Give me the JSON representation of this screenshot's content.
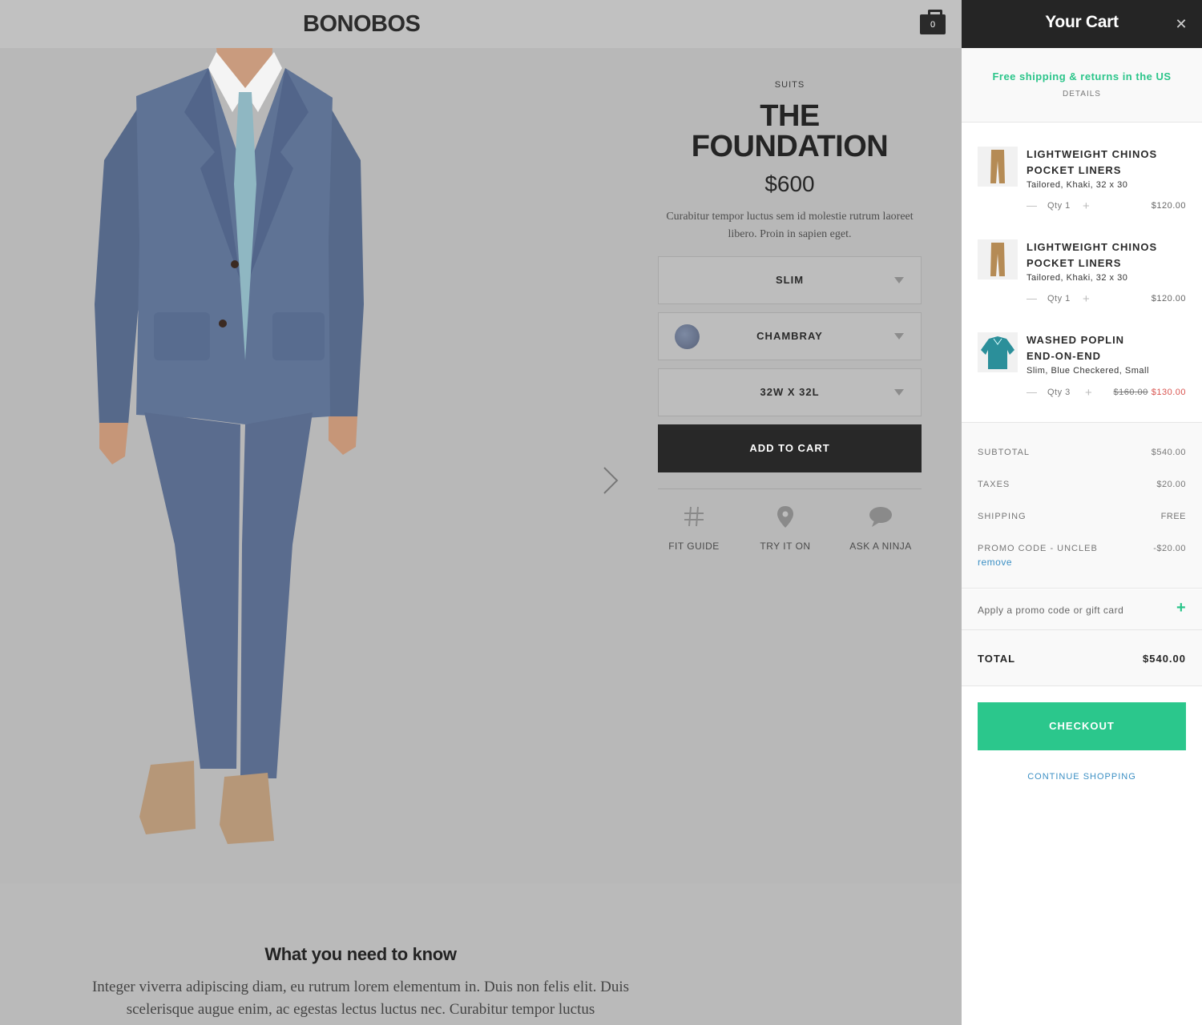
{
  "header": {
    "logo": "BONOBOS",
    "bag_count": "0"
  },
  "product": {
    "category": "SUITS",
    "title_line1": "THE",
    "title_line2": "FOUNDATION",
    "price": "$600",
    "description": "Curabitur tempor luctus sem id molestie rutrum laoreet libero. Proin in sapien eget.",
    "fit_select": "SLIM",
    "color_select": "CHAMBRAY",
    "size_select": "32W X 32L",
    "add_to_cart": "ADD TO CART",
    "tools": [
      {
        "label": "FIT GUIDE",
        "icon": "hash-icon"
      },
      {
        "label": "TRY IT ON",
        "icon": "location-pin-icon"
      },
      {
        "label": "ASK A NINJA",
        "icon": "chat-bubble-icon"
      }
    ]
  },
  "info": {
    "heading": "What you need to know",
    "body": "Integer viverra adipiscing diam, eu rutrum lorem elementum in. Duis non felis elit. Duis scelerisque augue enim, ac egestas lectus luctus nec. Curabitur tempor luctus"
  },
  "cart": {
    "title": "Your Cart",
    "close_icon": "close-icon",
    "shipping_note": "Free shipping & returns in the US",
    "details": "DETAILS",
    "items": [
      {
        "name_line1": "LIGHTWEIGHT CHINOS",
        "name_line2": "POCKET LINERS",
        "desc": "Tailored, Khaki, 32 x 30",
        "qty": "Qty 1",
        "price": "$120.00",
        "thumb": "khaki-chinos"
      },
      {
        "name_line1": "LIGHTWEIGHT CHINOS",
        "name_line2": "POCKET LINERS",
        "desc": "Tailored, Khaki, 32 x 30",
        "qty": "Qty 1",
        "price": "$120.00",
        "thumb": "khaki-chinos"
      },
      {
        "name_line1": "WASHED POPLIN",
        "name_line2": "END-ON-END",
        "desc": "Slim, Blue Checkered, Small",
        "qty": "Qty 3",
        "original_price": "$160.00",
        "price": "$130.00",
        "thumb": "blue-checkered-shirt"
      }
    ],
    "summary": {
      "subtotal_label": "SUBTOTAL",
      "subtotal": "$540.00",
      "taxes_label": "TAXES",
      "taxes": "$20.00",
      "shipping_label": "SHIPPING",
      "shipping": "FREE",
      "promo_label": "PROMO CODE - UNCLEB",
      "promo": "-$20.00",
      "remove": "remove"
    },
    "promo_prompt": "Apply a promo code or gift card",
    "total_label": "TOTAL",
    "total": "$540.00",
    "checkout": "CHECKOUT",
    "continue": "CONTINUE SHOPPING"
  },
  "colors": {
    "accent_green": "#2bc78c",
    "link_blue": "#3b8fc4",
    "sale_red": "#d9534f",
    "dark": "#252525"
  }
}
